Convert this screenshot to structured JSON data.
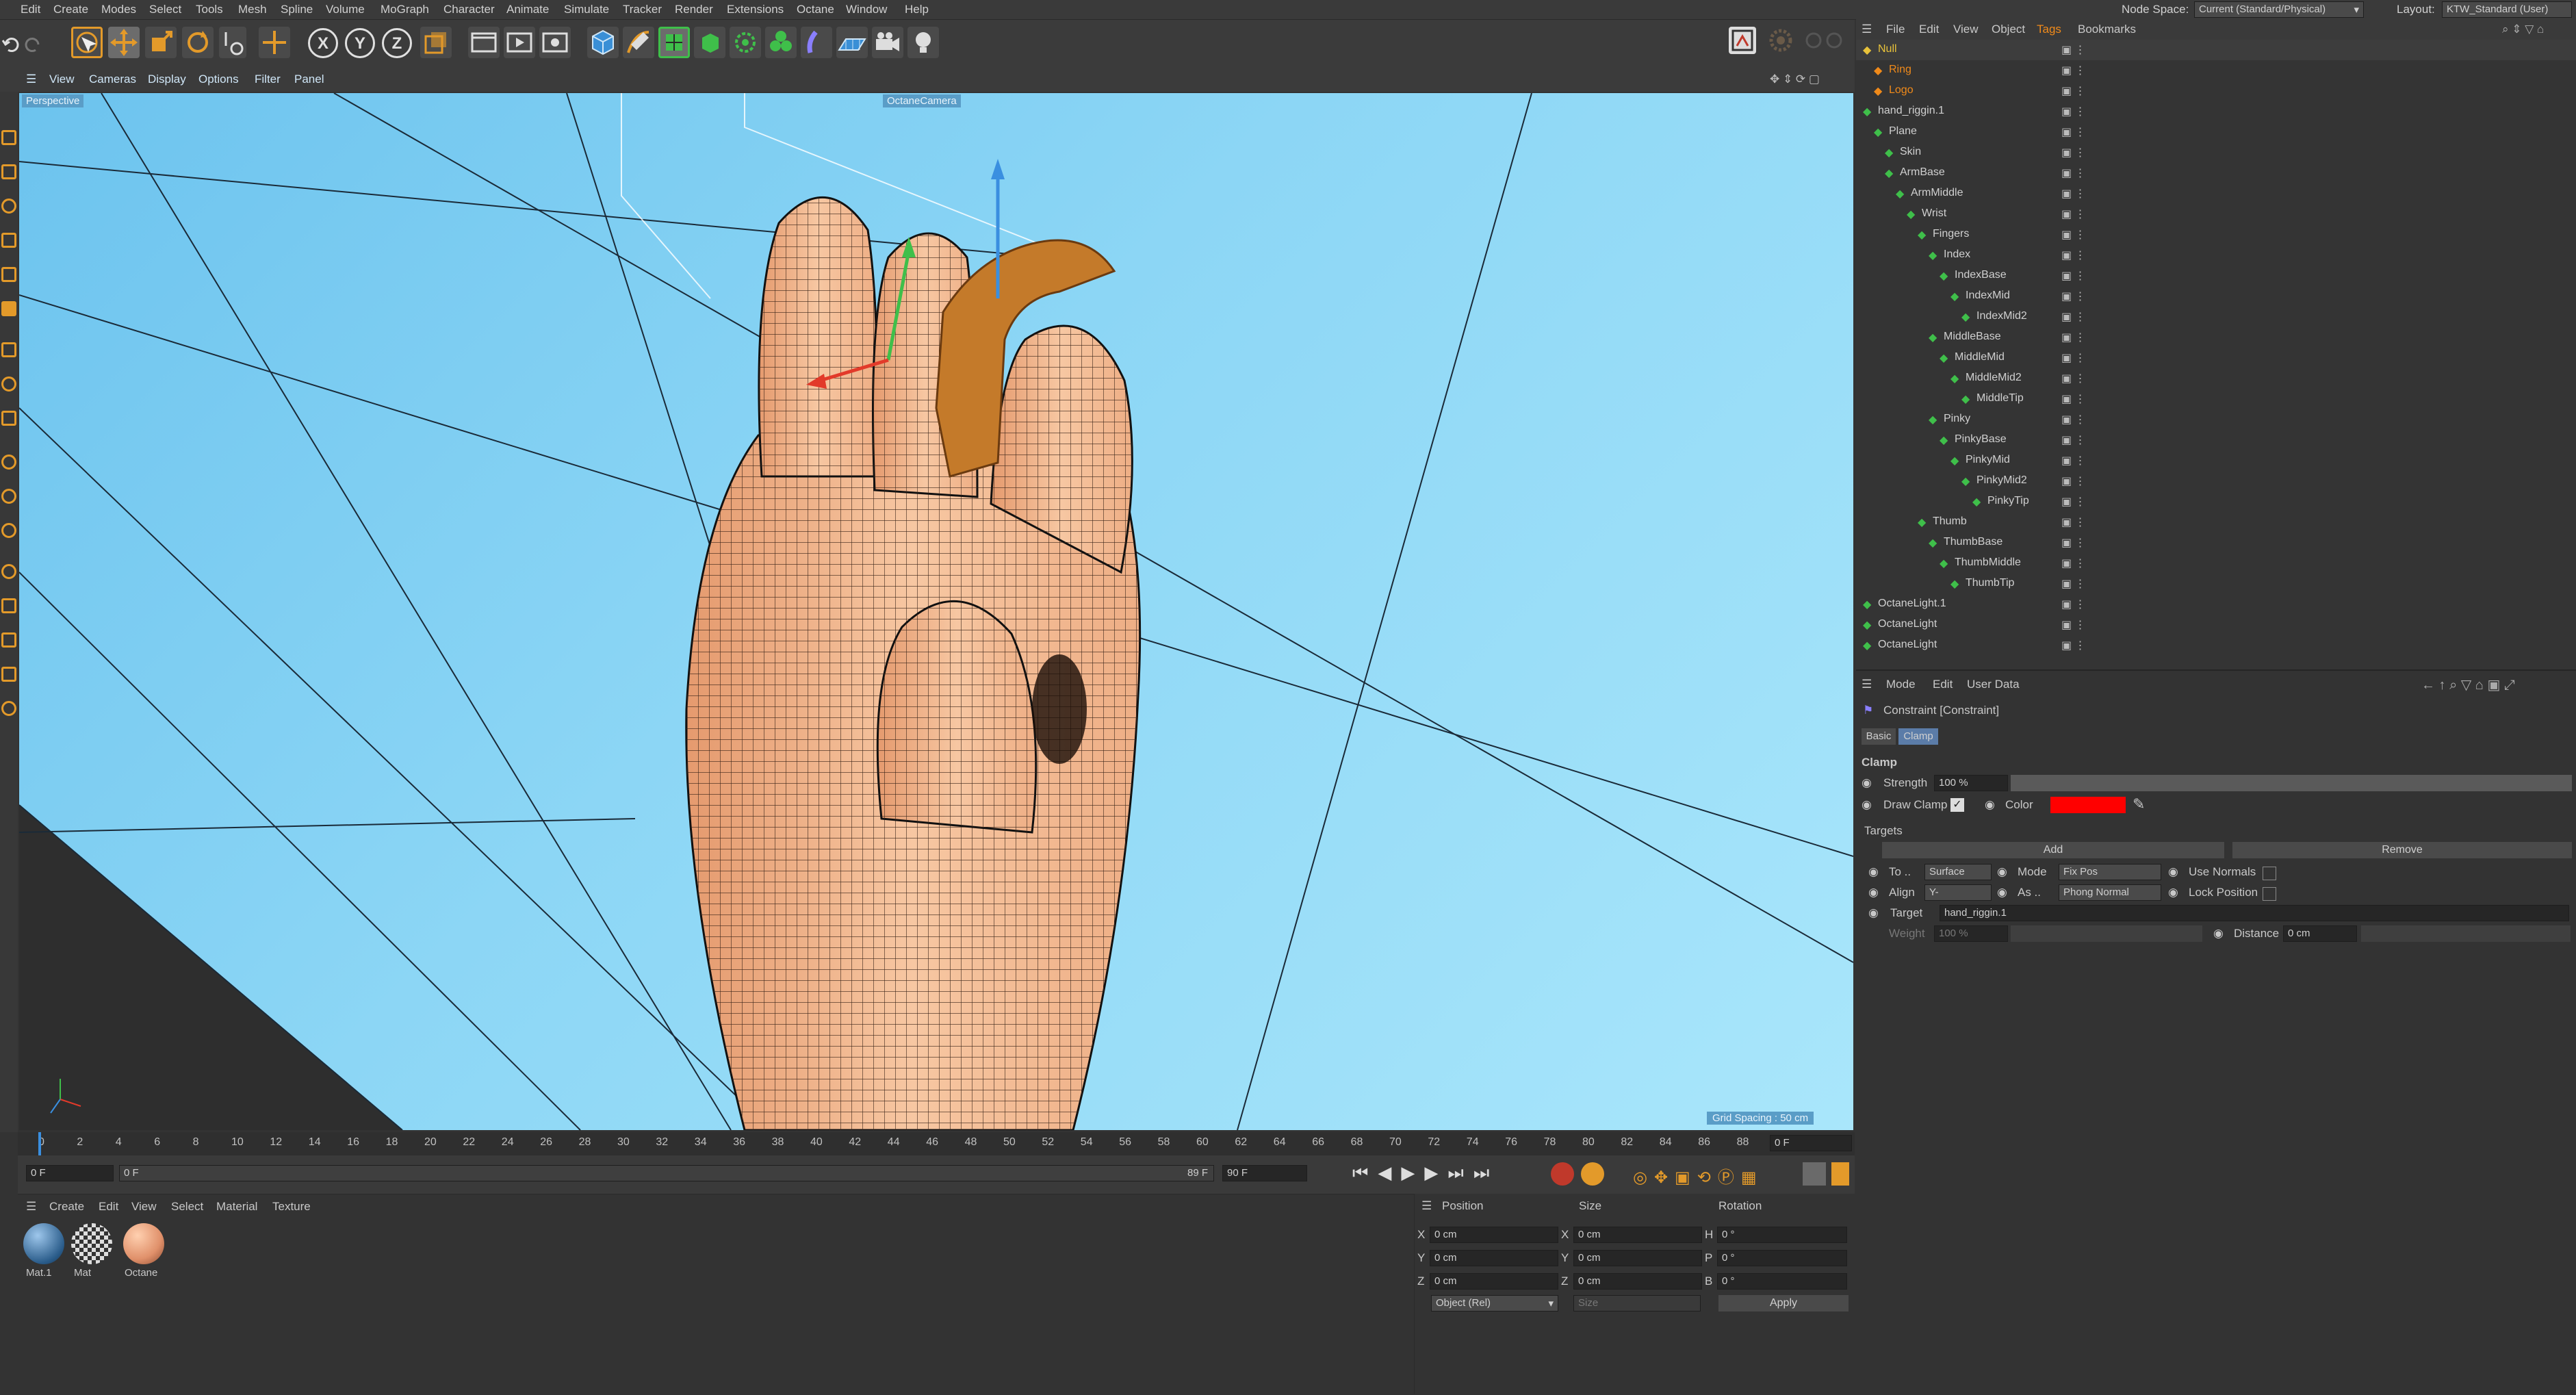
{
  "menubar": {
    "items": [
      "Edit",
      "Create",
      "Modes",
      "Select",
      "Tools",
      "Mesh",
      "Spline",
      "Volume",
      "MoGraph",
      "Character",
      "Animate",
      "Simulate",
      "Tracker",
      "Render",
      "Extensions",
      "Octane",
      "Window",
      "Help"
    ],
    "node_space_label": "Node Space:",
    "node_space_value": "Current (Standard/Physical)",
    "layout_label": "Layout:",
    "layout_value": "KTW_Standard (User)"
  },
  "toolbar": {
    "axis_x": "X",
    "axis_y": "Y",
    "axis_z": "Z"
  },
  "viewport_menu": [
    "View",
    "Cameras",
    "Display",
    "Options",
    "Filter",
    "Panel"
  ],
  "viewport": {
    "view_name": "Perspective",
    "camera_name": "OctaneCamera",
    "grid_spacing": "Grid Spacing : 50 cm"
  },
  "timeline": {
    "ticks": [
      "0",
      "2",
      "4",
      "6",
      "8",
      "10",
      "12",
      "14",
      "16",
      "18",
      "20",
      "22",
      "24",
      "26",
      "28",
      "30",
      "32",
      "34",
      "36",
      "38",
      "40",
      "42",
      "44",
      "46",
      "48",
      "50",
      "52",
      "54",
      "56",
      "58",
      "60",
      "62",
      "64",
      "66",
      "68",
      "70",
      "72",
      "74",
      "76",
      "78",
      "80",
      "82",
      "84",
      "86",
      "88"
    ],
    "current_frame_right": "0 F",
    "start_field": "0 F",
    "start_field2": "0 F",
    "end_frame_label": "89 F",
    "end_field": "90 F"
  },
  "material_manager": {
    "menu": [
      "Create",
      "Edit",
      "View",
      "Select",
      "Material",
      "Texture"
    ],
    "materials": [
      {
        "name": "Mat.1"
      },
      {
        "name": "Mat"
      },
      {
        "name": "Octane"
      }
    ]
  },
  "coordinates": {
    "headers": [
      "Position",
      "Size",
      "Rotation"
    ],
    "rows": [
      {
        "axis": "X",
        "pos": "0 cm",
        "size_axis": "X",
        "size": "0 cm",
        "rot_axis": "H",
        "rot": "0 °"
      },
      {
        "axis": "Y",
        "pos": "0 cm",
        "size_axis": "Y",
        "size": "0 cm",
        "rot_axis": "P",
        "rot": "0 °"
      },
      {
        "axis": "Z",
        "pos": "0 cm",
        "size_axis": "Z",
        "size": "0 cm",
        "rot_axis": "B",
        "rot": "0 °"
      }
    ],
    "mode": "Object (Rel)",
    "size_mode": "Size",
    "apply_label": "Apply"
  },
  "object_manager": {
    "menu": [
      "File",
      "Edit",
      "View",
      "Object",
      "Tags",
      "Bookmarks"
    ],
    "objects": [
      {
        "name": "Null",
        "color": "yellow",
        "indent": 0
      },
      {
        "name": "Ring",
        "color": "orange",
        "indent": 1
      },
      {
        "name": "Logo",
        "color": "orange",
        "indent": 1
      },
      {
        "name": "hand_riggin.1",
        "color": "white",
        "indent": 0
      },
      {
        "name": "Plane",
        "color": "white",
        "indent": 1
      },
      {
        "name": "Skin",
        "color": "white",
        "indent": 2
      },
      {
        "name": "ArmBase",
        "color": "white",
        "indent": 2
      },
      {
        "name": "ArmMiddle",
        "color": "white",
        "indent": 3
      },
      {
        "name": "Wrist",
        "color": "white",
        "indent": 4
      },
      {
        "name": "Fingers",
        "color": "white",
        "indent": 5
      },
      {
        "name": "Index",
        "color": "white",
        "indent": 6
      },
      {
        "name": "IndexBase",
        "color": "white",
        "indent": 7
      },
      {
        "name": "IndexMid",
        "color": "white",
        "indent": 8
      },
      {
        "name": "IndexMid2",
        "color": "white",
        "indent": 9
      },
      {
        "name": "MiddleBase",
        "color": "white",
        "indent": 6
      },
      {
        "name": "MiddleMid",
        "color": "white",
        "indent": 7
      },
      {
        "name": "MiddleMid2",
        "color": "white",
        "indent": 8
      },
      {
        "name": "MiddleTip",
        "color": "white",
        "indent": 9
      },
      {
        "name": "Pinky",
        "color": "white",
        "indent": 6
      },
      {
        "name": "PinkyBase",
        "color": "white",
        "indent": 7
      },
      {
        "name": "PinkyMid",
        "color": "white",
        "indent": 8
      },
      {
        "name": "PinkyMid2",
        "color": "white",
        "indent": 9
      },
      {
        "name": "PinkyTip",
        "color": "white",
        "indent": 10
      },
      {
        "name": "Thumb",
        "color": "white",
        "indent": 5
      },
      {
        "name": "ThumbBase",
        "color": "white",
        "indent": 6
      },
      {
        "name": "ThumbMiddle",
        "color": "white",
        "indent": 7
      },
      {
        "name": "ThumbTip",
        "color": "white",
        "indent": 8
      },
      {
        "name": "OctaneLight.1",
        "color": "white",
        "indent": 0
      },
      {
        "name": "OctaneLight",
        "color": "white",
        "indent": 0
      },
      {
        "name": "OctaneLight",
        "color": "white",
        "indent": 0
      }
    ]
  },
  "attributes": {
    "menu": [
      "Mode",
      "Edit",
      "User Data"
    ],
    "title": "Constraint [Constraint]",
    "tabs": [
      "Basic",
      "Clamp"
    ],
    "active_tab": "Clamp",
    "section": "Clamp",
    "strength_label": "Strength",
    "strength_value": "100 %",
    "draw_clamp_label": "Draw Clamp",
    "color_label": "Color",
    "color_value": "#ff0000",
    "targets_label": "Targets",
    "add_label": "Add",
    "remove_label": "Remove",
    "to_label": "To ..",
    "to_value": "Surface",
    "mode_label": "Mode",
    "mode_value": "Fix Pos",
    "use_normals_label": "Use Normals",
    "align_label": "Align",
    "align_value": "Y-",
    "as_label": "As ..",
    "as_value": "Phong Normal",
    "lock_position_label": "Lock Position",
    "target_label": "Target",
    "target_value": "hand_riggin.1",
    "weight_label": "Weight",
    "weight_value": "100 %",
    "distance_label": "Distance",
    "distance_value": "0 cm"
  }
}
